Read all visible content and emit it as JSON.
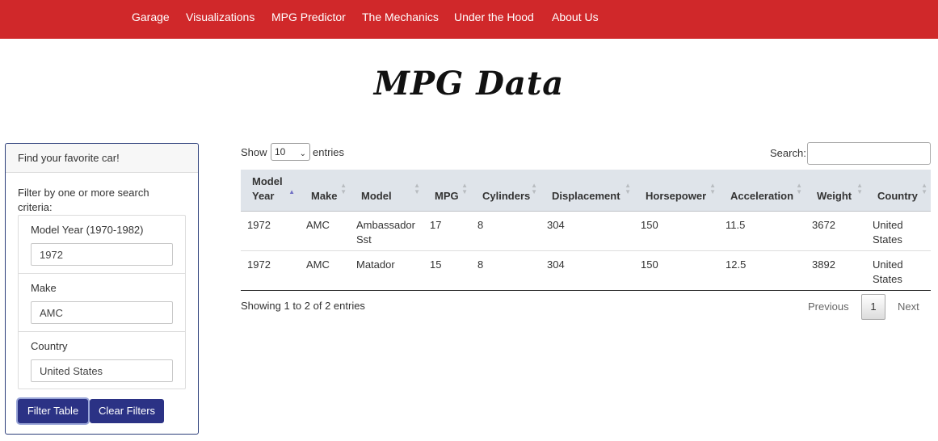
{
  "nav": {
    "items": [
      {
        "label": "Garage"
      },
      {
        "label": "Visualizations"
      },
      {
        "label": "MPG Predictor"
      },
      {
        "label": "The Mechanics"
      },
      {
        "label": "Under the Hood"
      },
      {
        "label": "About Us"
      }
    ]
  },
  "page": {
    "title": "MPG Data"
  },
  "filter": {
    "header": "Find your favorite car!",
    "instructions": "Filter by one or more search criteria:",
    "fields": [
      {
        "label": "Model Year (1970-1982)",
        "value": "1972"
      },
      {
        "label": "Make",
        "value": "AMC"
      },
      {
        "label": "Country",
        "value": "United States"
      }
    ],
    "filter_button": "Filter Table",
    "clear_button": "Clear Filters"
  },
  "table": {
    "length": {
      "show_label": "Show",
      "selected": "10",
      "entries_label": "entries"
    },
    "search_label": "Search:",
    "search_value": "",
    "columns": [
      {
        "line1": "Model",
        "line2": "Year"
      },
      {
        "line1": "",
        "line2": "Make"
      },
      {
        "line1": "",
        "line2": "Model"
      },
      {
        "line1": "",
        "line2": "MPG"
      },
      {
        "line1": "",
        "line2": "Cylinders"
      },
      {
        "line1": "",
        "line2": "Displacement"
      },
      {
        "line1": "",
        "line2": "Horsepower"
      },
      {
        "line1": "",
        "line2": "Acceleration"
      },
      {
        "line1": "",
        "line2": "Weight"
      },
      {
        "line1": "",
        "line2": "Country"
      }
    ],
    "sorted_column": "Model Year",
    "rows": [
      {
        "year": "1972",
        "make": "AMC",
        "model_l1": "Ambassador",
        "model_l2": "Sst",
        "mpg": "17",
        "cylinders": "8",
        "displacement": "304",
        "horsepower": "150",
        "acceleration": "11.5",
        "weight": "3672",
        "country_l1": "United",
        "country_l2": "States"
      },
      {
        "year": "1972",
        "make": "AMC",
        "model_l1": "Matador",
        "model_l2": "",
        "mpg": "15",
        "cylinders": "8",
        "displacement": "304",
        "horsepower": "150",
        "acceleration": "12.5",
        "weight": "3892",
        "country_l1": "United",
        "country_l2": "States"
      }
    ],
    "info": "Showing 1 to 2 of 2 entries",
    "pagination": {
      "previous": "Previous",
      "current": "1",
      "next": "Next"
    }
  }
}
